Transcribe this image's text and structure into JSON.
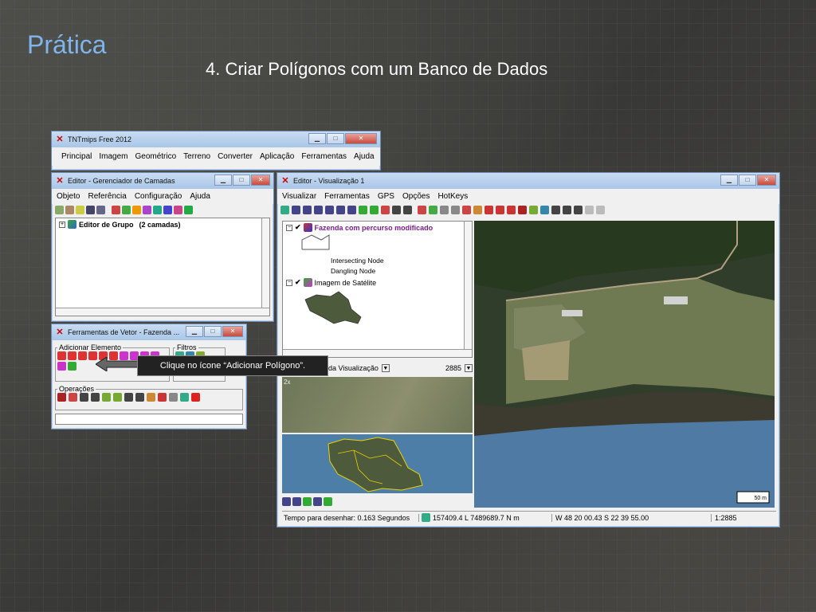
{
  "slide": {
    "title": "Prática",
    "subtitle": "4. Criar Polígonos com um Banco de Dados"
  },
  "main_window": {
    "title": "TNTmips Free 2012",
    "menu": [
      "Principal",
      "Imagem",
      "Geométrico",
      "Terreno",
      "Converter",
      "Aplicação",
      "Ferramentas",
      "Ajuda"
    ]
  },
  "layer_manager": {
    "title": "Editor - Gerenciador de Camadas",
    "menu": [
      "Objeto",
      "Referência",
      "Configuração",
      "Ajuda"
    ],
    "group_label": "Editor de Grupo",
    "group_count": "(2 camadas)"
  },
  "vector_tools": {
    "title": "Ferramentas de Vetor - Fazenda ...",
    "add_element_label": "Adicionar Elemento",
    "filters_label": "Filtros",
    "operations_label": "Operações"
  },
  "callout": {
    "text": "Clique no ícone “Adicionar Polígono”."
  },
  "view_window": {
    "title": "Editor - Visualização 1",
    "menu": [
      "Visualizar",
      "Ferramentas",
      "GPS",
      "Opções",
      "HotKeys"
    ],
    "layers": {
      "layer1_name": "Fazenda com percurso modificado",
      "legend_intersecting": "Intersecting Node",
      "legend_dangling": "Dangling Node",
      "layer2_name": "Imagem de Satélite"
    },
    "locator_select": "da Visualização",
    "locator_scale": "2885",
    "zoom_label": "2x",
    "scalebar": "50 m",
    "status": {
      "time": "Tempo para desenhar: 0.163 Segundos",
      "coords": "157409.4 L  7489689.7 N m",
      "latlon": "W 48 20 00.43  S 22 39 55.00",
      "scale": "1:2885"
    }
  },
  "colors": {
    "title_blue": "#7fb4ec",
    "layer1_text": "#7a1e8c",
    "callout_bg": "#222222"
  }
}
